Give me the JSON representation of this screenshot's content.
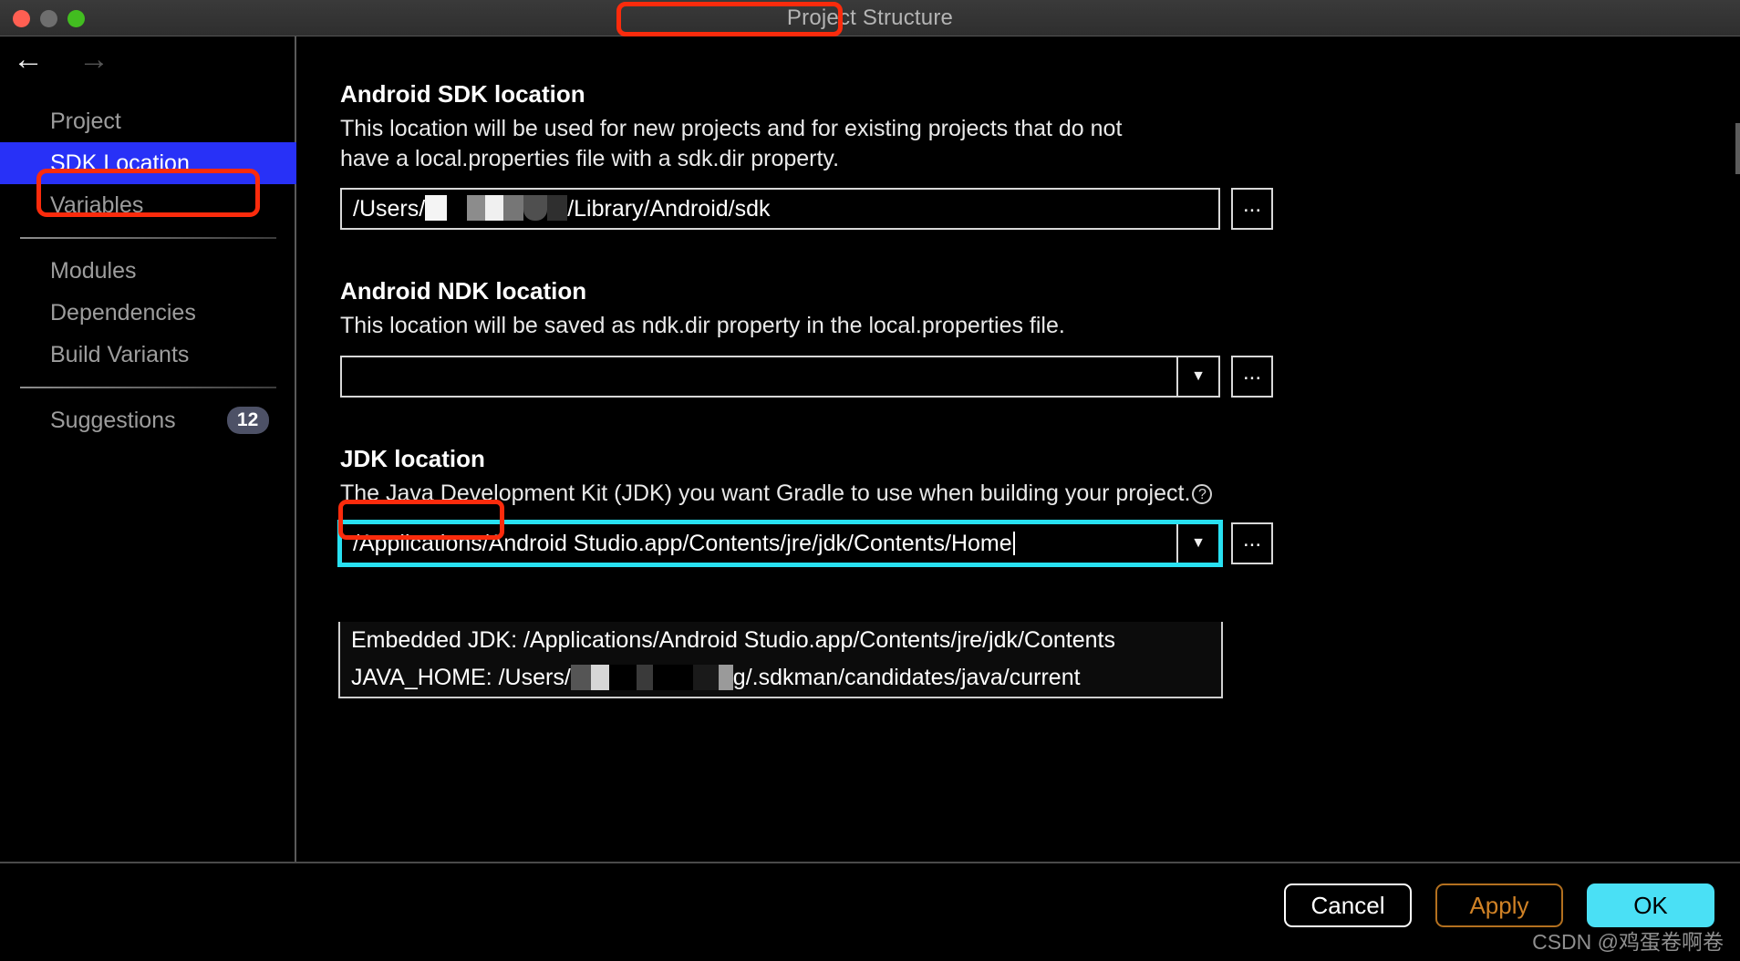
{
  "window": {
    "title": "Project Structure",
    "traffic_lights": [
      "close-button",
      "minimize-button",
      "zoom-button"
    ]
  },
  "nav": {
    "back_icon": "←",
    "forward_icon": "→"
  },
  "sidebar": {
    "items": [
      {
        "label": "Project",
        "selected": false,
        "badge": ""
      },
      {
        "label": "SDK Location",
        "selected": true,
        "badge": ""
      },
      {
        "label": "Variables",
        "selected": false,
        "badge": ""
      }
    ],
    "items2": [
      {
        "label": "Modules",
        "selected": false,
        "badge": ""
      },
      {
        "label": "Dependencies",
        "selected": false,
        "badge": ""
      },
      {
        "label": "Build Variants",
        "selected": false,
        "badge": ""
      }
    ],
    "suggestions": {
      "label": "Suggestions",
      "badge": "12"
    }
  },
  "main": {
    "sdk": {
      "title": "Android SDK location",
      "desc_line1": "This location will be used for new projects and for existing projects that do not",
      "desc_line2": "have a local.properties file with a sdk.dir property.",
      "value_prefix": "/Users/",
      "value_suffix": "/Library/Android/sdk",
      "redacted": true,
      "browse_label": "..."
    },
    "ndk": {
      "title": "Android NDK location",
      "desc_line1": "This location will be saved as ndk.dir property in the local.properties file.",
      "value": "",
      "dropdown_icon": "▼",
      "browse_label": "..."
    },
    "jdk": {
      "title": "JDK location",
      "desc_line1": "The Java Development Kit (JDK) you want Gradle to use when building your project.",
      "help_icon": "?",
      "value": "/Applications/Android Studio.app/Contents/jre/jdk/Contents/Home",
      "dropdown_icon": "▼",
      "browse_label": "...",
      "options": [
        {
          "text": "Embedded JDK: /Applications/Android Studio.app/Contents/jre/jdk/Contents"
        },
        {
          "text_prefix": "JAVA_HOME: /Users/",
          "text_suffix": "g/.sdkman/candidates/java/current",
          "redacted": true
        }
      ]
    }
  },
  "footer": {
    "cancel_label": "Cancel",
    "apply_label": "Apply",
    "ok_label": "OK",
    "watermark": "CSDN @鸡蛋卷啊卷"
  },
  "colors": {
    "annotation_red": "#fb2b0c",
    "selection_blue": "#2831f7",
    "focus_cyan": "#28e1f2",
    "ok_button": "#4ae0f5",
    "apply_text": "#d08226",
    "badge_bg": "#4d5166"
  }
}
